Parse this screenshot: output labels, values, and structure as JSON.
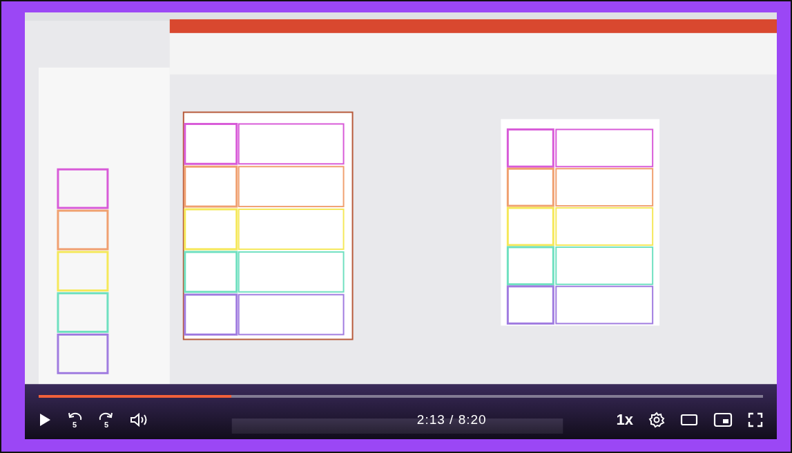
{
  "player": {
    "progress": {
      "level": 0.266
    },
    "time": "2:13 / 8:20",
    "speed": "1x",
    "rewind_label": "5",
    "forward_label": "5"
  }
}
